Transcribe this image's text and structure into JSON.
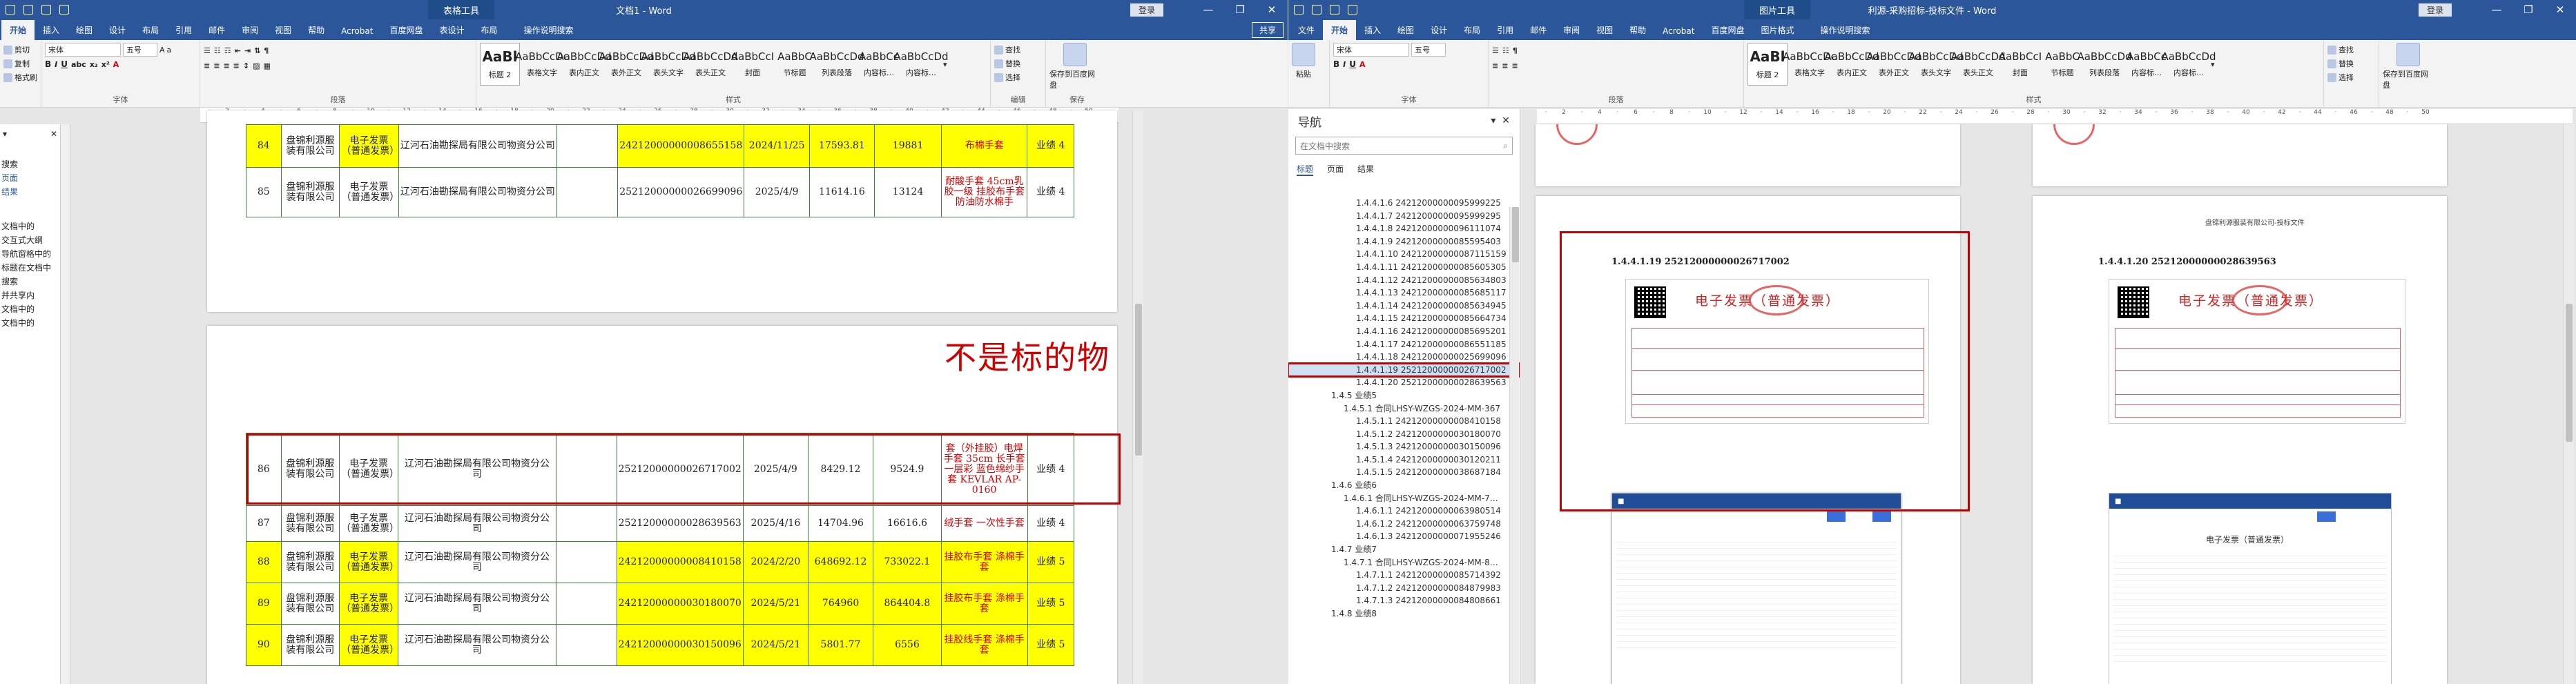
{
  "left_window": {
    "context_tab": "表格工具",
    "title": "文档1 - Word",
    "account": "登录",
    "tabs": [
      "开始",
      "插入",
      "绘图",
      "设计",
      "布局",
      "引用",
      "邮件",
      "审阅",
      "视图",
      "帮助",
      "Acrobat",
      "百度网盘",
      "表设计",
      "布局"
    ],
    "tell_me": "操作说明搜索",
    "share": "共享",
    "clipboard": {
      "paste": "粘贴",
      "cut": "剪切",
      "copy": "复制",
      "painter": "格式刷",
      "label": "剪贴板"
    },
    "font": {
      "name": "宋体",
      "size": "五号",
      "label": "字体"
    },
    "paragraph_label": "段落",
    "styles_label": "样式",
    "styles": [
      {
        "sample": "AaBl",
        "name": "标题 2"
      },
      {
        "sample": "AaBbCcDc",
        "name": "表格文字"
      },
      {
        "sample": "AaBbCcDd",
        "name": "表内正文"
      },
      {
        "sample": "AaBbCcDd",
        "name": "表外正文"
      },
      {
        "sample": "AaBbCcDd",
        "name": "表头文字"
      },
      {
        "sample": "AaBbCcDd",
        "name": "表头正文"
      },
      {
        "sample": "AaBbCcI",
        "name": "封面"
      },
      {
        "sample": "AaBbC",
        "name": "节标题"
      },
      {
        "sample": "AaBbCcDd",
        "name": "列表段落"
      },
      {
        "sample": "AaBbCc",
        "name": "内容标…"
      },
      {
        "sample": "AaBbCcDd",
        "name": "内容标…"
      }
    ],
    "editing": {
      "find": "查找",
      "replace": "替换",
      "select": "选择",
      "label": "编辑"
    },
    "save": {
      "label": "保存到百度网盘",
      "group": "保存"
    },
    "nav_fragments": [
      "搜索",
      "页面",
      "结果",
      "文档中的",
      "交互式大纲",
      "导航窗格中的",
      "标题在文档中",
      "搜索",
      "并共享内",
      "文档中的",
      "文档中的"
    ],
    "big_title": "不是标的物",
    "rows_top": [
      {
        "no": "84",
        "buyer": "盘锦利源服装有限公司",
        "type": "电子发票（普通发票）",
        "seller": "辽河石油勘探局有限公司物资分公司",
        "code": "24212000000008655158",
        "date": "2024/11/25",
        "amount": "17593.81",
        "tax": "19881",
        "item": "布棉手套",
        "agent": "业绩 4",
        "hl": true
      },
      {
        "no": "85",
        "buyer": "盘锦利源服装有限公司",
        "type": "电子发票（普通发票）",
        "seller": "辽河石油勘探局有限公司物资分公司",
        "code": "25212000000026699096",
        "date": "2025/4/9",
        "amount": "11614.16",
        "tax": "13124",
        "item": "耐酸手套 45cm乳胶一级 挂胶布手套防油防水棉手",
        "agent": "业绩 4",
        "hl": false
      }
    ],
    "rows_bottom": [
      {
        "no": "86",
        "buyer": "盘锦利源服装有限公司",
        "type": "电子发票（普通发票）",
        "seller": "辽河石油勘探局有限公司物资分公司",
        "code": "25212000000026717002",
        "date": "2025/4/9",
        "amount": "8429.12",
        "tax": "9524.9",
        "item": "套（外挂胶）电焊手套 35cm 长手套一层彩 蓝色绵纱手套 KEVLAR AP-0160",
        "agent": "业绩 4",
        "hl": false
      },
      {
        "no": "87",
        "buyer": "盘锦利源服装有限公司",
        "type": "电子发票（普通发票）",
        "seller": "辽河石油勘探局有限公司物资分公司",
        "code": "25212000000028639563",
        "date": "2025/4/16",
        "amount": "14704.96",
        "tax": "16616.6",
        "item": "绒手套 一次性手套",
        "agent": "业绩 4",
        "hl": false
      },
      {
        "no": "88",
        "buyer": "盘锦利源服装有限公司",
        "type": "电子发票（普通发票）",
        "seller": "辽河石油勘探局有限公司物资分公司",
        "code": "24212000000008410158",
        "date": "2024/2/20",
        "amount": "648692.12",
        "tax": "733022.1",
        "item": "挂胶布手套 涤棉手套",
        "agent": "业绩 5",
        "hl": true
      },
      {
        "no": "89",
        "buyer": "盘锦利源服装有限公司",
        "type": "电子发票（普通发票）",
        "seller": "辽河石油勘探局有限公司物资分公司",
        "code": "24212000000030180070",
        "date": "2024/5/21",
        "amount": "764960",
        "tax": "864404.8",
        "item": "挂胶布手套 涤棉手套",
        "agent": "业绩 5",
        "hl": true
      },
      {
        "no": "90",
        "buyer": "盘锦利源服装有限公司",
        "type": "电子发票（普通发票）",
        "seller": "辽河石油勘探局有限公司物资分公司",
        "code": "24212000000030150096",
        "date": "2024/5/21",
        "amount": "5801.77",
        "tax": "6556",
        "item": "挂胶线手套 涤棉手套",
        "agent": "业绩 5",
        "hl": true
      }
    ]
  },
  "right_window": {
    "context_tab": "图片工具",
    "title": "利源-采购招标-投标文件 - Word",
    "account": "登录",
    "tabs": [
      "文件",
      "开始",
      "插入",
      "绘图",
      "设计",
      "布局",
      "引用",
      "邮件",
      "审阅",
      "视图",
      "帮助",
      "Acrobat",
      "百度网盘",
      "图片格式"
    ],
    "tell_me": "操作说明搜索",
    "nav": {
      "title": "导航",
      "search_placeholder": "在文档中搜索",
      "tabs": [
        "标题",
        "页面",
        "结果"
      ],
      "items": [
        "1.4.4.1.6 24212000000095999225",
        "1.4.4.1.7 24212000000095999295",
        "1.4.4.1.8 24212000000096111074",
        "1.4.4.1.9 24212000000085595403",
        "1.4.4.1.10 24212000000087115159",
        "1.4.4.1.11 24212000000085605305",
        "1.4.4.1.12 24212000000085634803",
        "1.4.4.1.13 24212000000085685117",
        "1.4.4.1.14 24212000000085634945",
        "1.4.4.1.15 24212000000085664734",
        "1.4.4.1.16 24212000000085695201",
        "1.4.4.1.17 24212000000086551185",
        "1.4.4.1.18 24212000000025699096",
        "1.4.4.1.19 25212000000026717002",
        "1.4.4.1.20 25212000000028639563",
        "1.4.5 业绩5",
        "1.4.5.1 合同LHSY-WZGS-2024-MM-367",
        "1.4.5.1.1 24212000000008410158",
        "1.4.5.1.2 24212000000030180070",
        "1.4.5.1.3 24212000000030150096",
        "1.4.5.1.4 24212000000030120211",
        "1.4.5.1.5 24212000000038687184",
        "1.4.6 业绩6",
        "1.4.6.1 合同LHSY-WZGS-2024-MM-7…",
        "1.4.6.1.1 24212000000063980514",
        "1.4.6.1.2 24212000000063759748",
        "1.4.6.1.3 24212000000071955246",
        "1.4.7 业绩7",
        "1.4.7.1 合同LHSY-WZGS-2024-MM-8…",
        "1.4.7.1.1 24212000000085714392",
        "1.4.7.1.2 24212000000084879983",
        "1.4.7.1.3 24212000000084808661",
        "1.4.8 业绩8"
      ]
    },
    "page_header": "盘锦利源服装有限公司-投标文件",
    "invoice_left": {
      "heading": "1.4.4.1.19 25212000000026717002",
      "title": "电子发票（普通发票）"
    },
    "invoice_right": {
      "heading": "1.4.4.1.20 25212000000028639563",
      "title": "电子发票（普通发票）"
    },
    "bank_title": "电子发票（普通发票）"
  }
}
